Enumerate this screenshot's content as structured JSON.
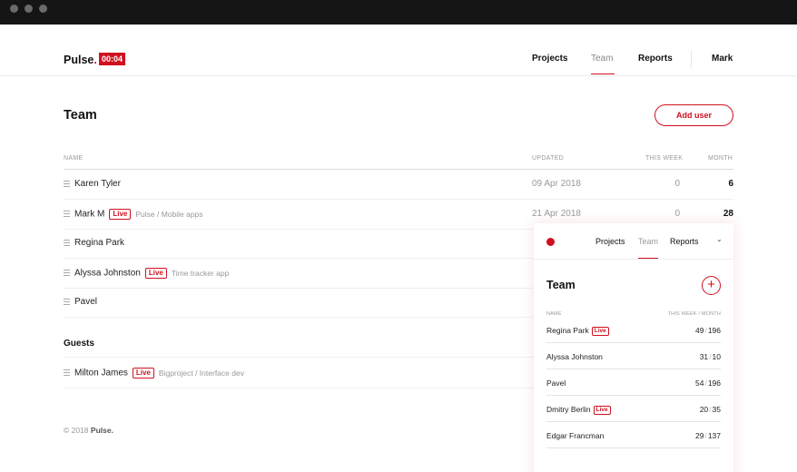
{
  "app": {
    "logo": "Pulse",
    "logo_dot": ".",
    "timer": "00:04"
  },
  "nav": {
    "projects": "Projects",
    "team": "Team",
    "reports": "Reports",
    "user": "Mark"
  },
  "page": {
    "title": "Team",
    "add_user_label": "Add user"
  },
  "table": {
    "headers": {
      "name": "NAME",
      "updated": "UPDATED",
      "this_week": "THIS WEEK",
      "month": "MONTH"
    },
    "rows": [
      {
        "name": "Karen Tyler",
        "live": "",
        "project": "",
        "updated": "09 Apr 2018",
        "week": "0",
        "month": "6"
      },
      {
        "name": "Mark M",
        "live": "Live",
        "project": "Pulse / Mobile apps",
        "updated": "21 Apr 2018",
        "week": "0",
        "month": "28"
      },
      {
        "name": "Regina Park",
        "live": "",
        "project": "",
        "updated": "",
        "week": "",
        "month": ""
      },
      {
        "name": "Alyssa Johnston",
        "live": "Live",
        "project": "Time tracker app",
        "updated": "",
        "week": "",
        "month": ""
      },
      {
        "name": "Pavel",
        "live": "",
        "project": "",
        "updated": "",
        "week": "",
        "month": ""
      }
    ]
  },
  "guests": {
    "label": "Guests",
    "rows": [
      {
        "name": "Milton James",
        "live": "Live",
        "project": "Bigproject / Interface dev"
      }
    ]
  },
  "footer": {
    "copyright": "© 2018",
    "brand": "Pulse."
  },
  "mobile": {
    "nav": {
      "projects": "Projects",
      "team": "Team",
      "reports": "Reports",
      "chevron": "⌄"
    },
    "title": "Team",
    "add_symbol": "+",
    "headers": {
      "name": "NAME",
      "stats": "THIS WEEK / MONTH"
    },
    "rows": [
      {
        "name": "Regina Park",
        "live": "Live",
        "week": "49",
        "month": "196"
      },
      {
        "name": "Alyssa Johnston",
        "live": "",
        "week": "31",
        "month": "10"
      },
      {
        "name": "Pavel",
        "live": "",
        "week": "54",
        "month": "196"
      },
      {
        "name": "Dmitry Berlin",
        "live": "Live",
        "week": "20",
        "month": "35"
      },
      {
        "name": "Edgar Francman",
        "live": "",
        "week": "29",
        "month": "137"
      }
    ]
  },
  "colors": {
    "accent": "#d0101f",
    "titlebar": "#151515",
    "muted": "#999999"
  }
}
